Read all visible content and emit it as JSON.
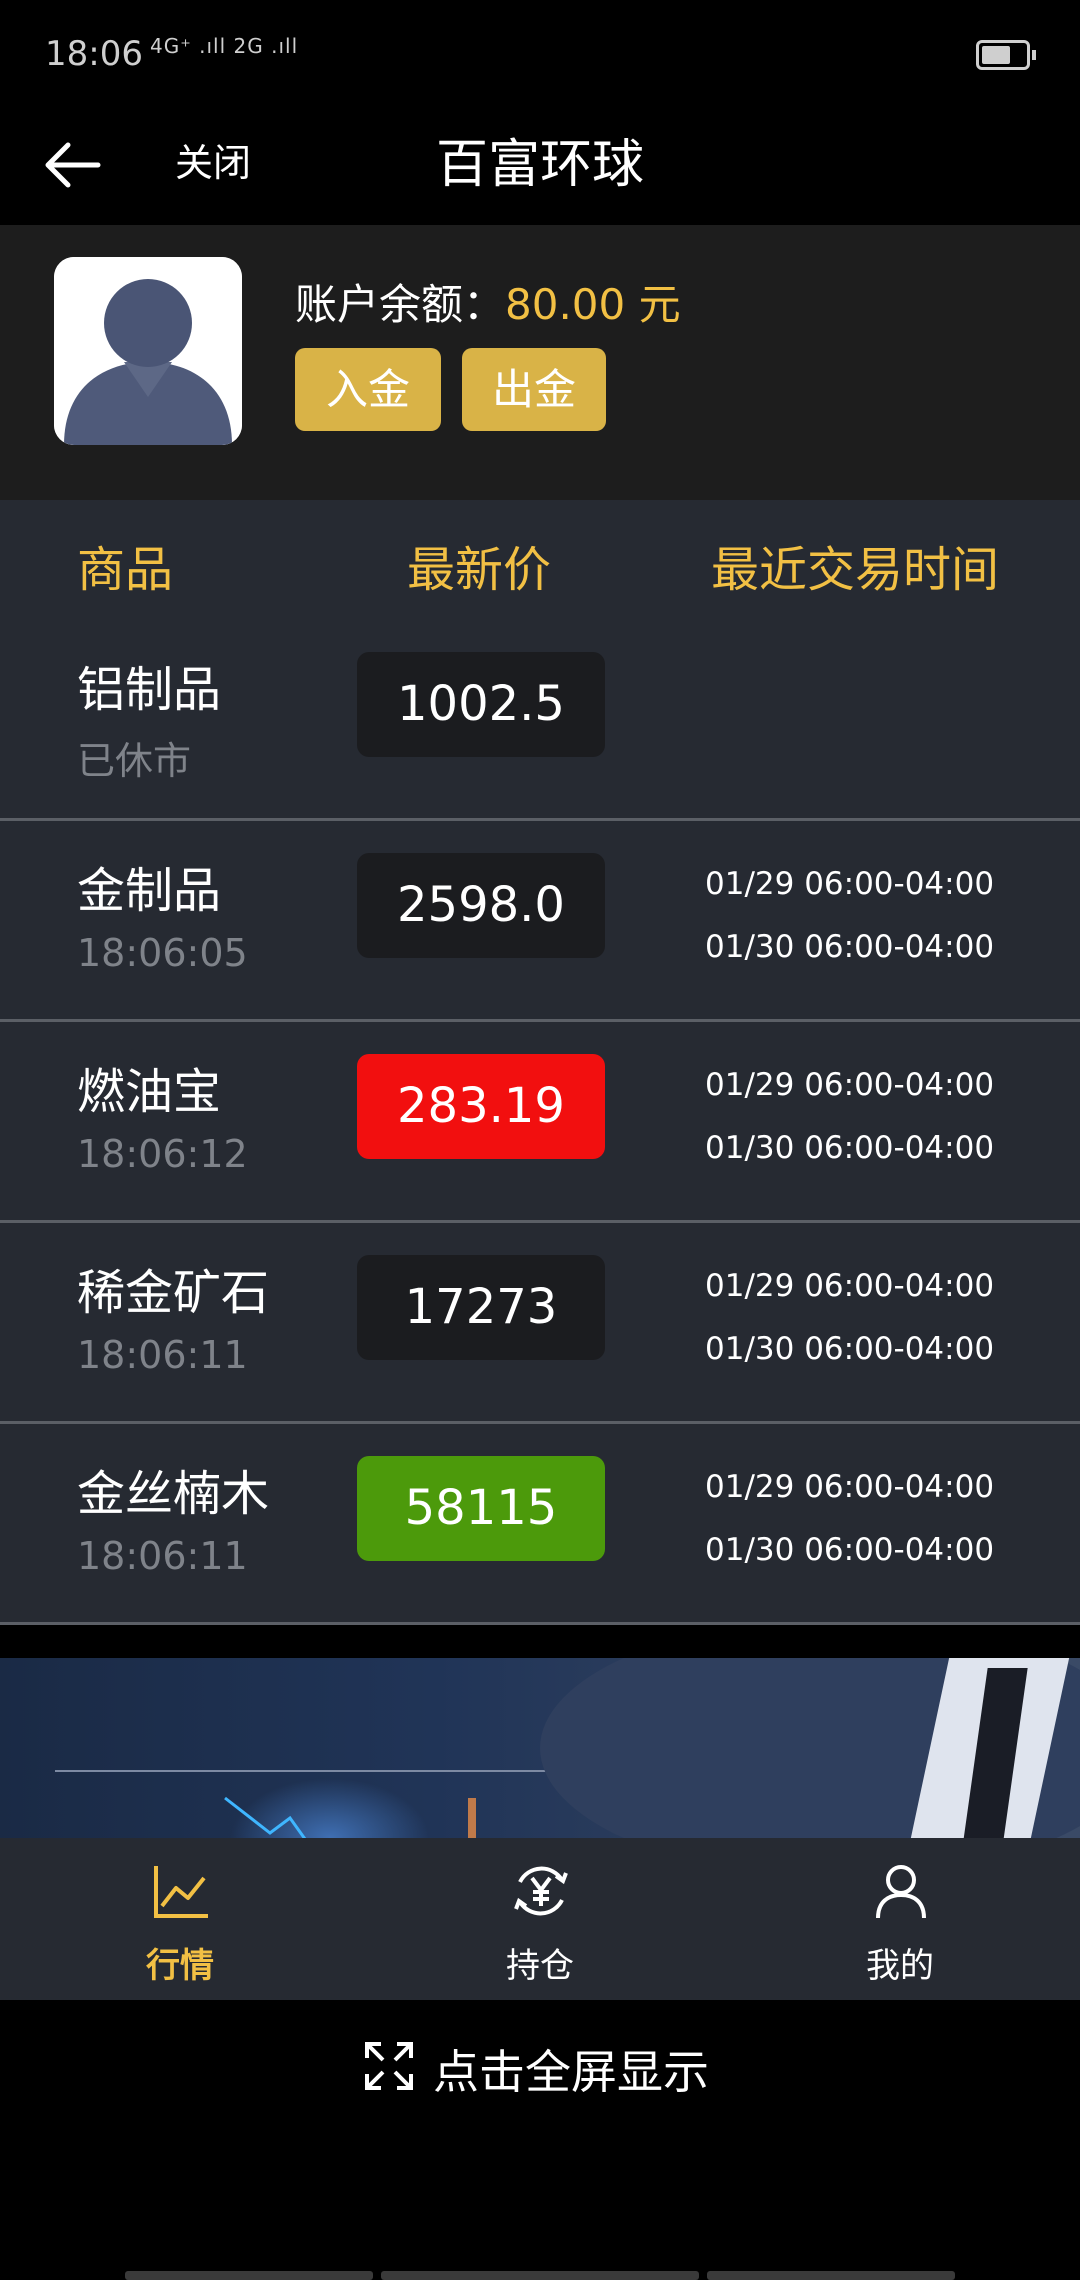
{
  "status": {
    "time": "18:06",
    "signal": "4G⁺ .ıll 2G .ıll"
  },
  "nav": {
    "close": "关闭",
    "title": "百富环球"
  },
  "account": {
    "balance_label": "账户余额：",
    "balance_value": "80.00 元",
    "deposit": "入金",
    "withdraw": "出金"
  },
  "table": {
    "headers": [
      "商品",
      "最新价",
      "最近交易时间"
    ],
    "rows": [
      {
        "name": "铝制品",
        "sub": "已休市",
        "price": "1002.5",
        "trend": "flat",
        "t1": "",
        "t2": ""
      },
      {
        "name": "金制品",
        "sub": "18:06:05",
        "price": "2598.0",
        "trend": "flat",
        "t1": "01/29 06:00-04:00",
        "t2": "01/30 06:00-04:00"
      },
      {
        "name": "燃油宝",
        "sub": "18:06:12",
        "price": "283.19",
        "trend": "up",
        "t1": "01/29 06:00-04:00",
        "t2": "01/30 06:00-04:00"
      },
      {
        "name": "稀金矿石",
        "sub": "18:06:11",
        "price": "17273",
        "trend": "flat",
        "t1": "01/29 06:00-04:00",
        "t2": "01/30 06:00-04:00"
      },
      {
        "name": "金丝楠木",
        "sub": "18:06:11",
        "price": "58115",
        "trend": "down",
        "t1": "01/29 06:00-04:00",
        "t2": "01/30 06:00-04:00"
      }
    ]
  },
  "tabs": [
    {
      "label": "行情",
      "icon": "chart-line-icon",
      "active": true
    },
    {
      "label": "持仓",
      "icon": "yen-exchange-icon",
      "active": false
    },
    {
      "label": "我的",
      "icon": "user-icon",
      "active": false
    }
  ],
  "fullscreen": {
    "label": "点击全屏显示"
  },
  "colors": {
    "accent": "#f2c044",
    "up": "#f20f0f",
    "down": "#4c9a0b",
    "row_bg": "#262a32"
  }
}
